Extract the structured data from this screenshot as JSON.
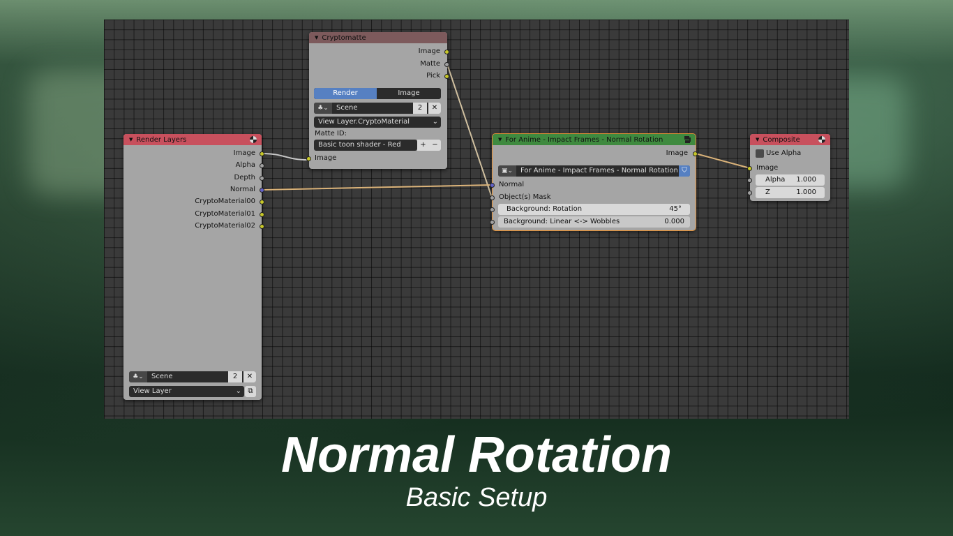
{
  "nodes": {
    "render_layers": {
      "title": "Render Layers",
      "outputs": [
        "Image",
        "Alpha",
        "Depth",
        "Normal",
        "CryptoMaterial00",
        "CryptoMaterial01",
        "CryptoMaterial02"
      ],
      "scene_label": "Scene",
      "scene_count": "2",
      "view_layer": "View Layer"
    },
    "cryptomatte": {
      "title": "Cryptomatte",
      "outputs": [
        "Image",
        "Matte",
        "Pick"
      ],
      "tab_render": "Render",
      "tab_image": "Image",
      "scene_label": "Scene",
      "scene_count": "2",
      "layer_select": "View Layer.CryptoMaterial",
      "matte_id_label": "Matte ID:",
      "matte_id_value": "Basic toon shader - Red",
      "input_image": "Image"
    },
    "group": {
      "title": "For Anime - Impact Frames - Normal Rotation",
      "output_image": "Image",
      "datablock": "For Anime - Impact Frames - Normal Rotation",
      "input_normal": "Normal",
      "input_mask": "Object(s) Mask",
      "bg_rotation_label": "Background: Rotation",
      "bg_rotation_value": "45°",
      "bg_wobble_label": "Background: Linear <-> Wobbles",
      "bg_wobble_value": "0.000"
    },
    "composite": {
      "title": "Composite",
      "use_alpha": "Use Alpha",
      "input_image": "Image",
      "alpha_label": "Alpha",
      "alpha_value": "1.000",
      "z_label": "Z",
      "z_value": "1.000"
    }
  },
  "caption": {
    "title": "Normal Rotation",
    "subtitle": "Basic Setup"
  },
  "colors": {
    "header_input": "#c8505d",
    "header_cryptomatte": "#7d5a5c",
    "header_group": "#3f8a3f",
    "socket_color": "#c7c729",
    "socket_vector": "#6363c7",
    "socket_value": "#a1a1a1",
    "active_tab": "#5680c2",
    "selected_outline": "#e39036"
  },
  "icons": {
    "collapse": "triangle-down-icon",
    "render": "sphere-icon",
    "scene": "scene-icon",
    "close": "x-icon",
    "plus": "plus-icon",
    "minus": "minus-icon",
    "dropdown": "chevron-down-icon",
    "group": "node-tree-icon",
    "fake_user": "shield-icon"
  }
}
